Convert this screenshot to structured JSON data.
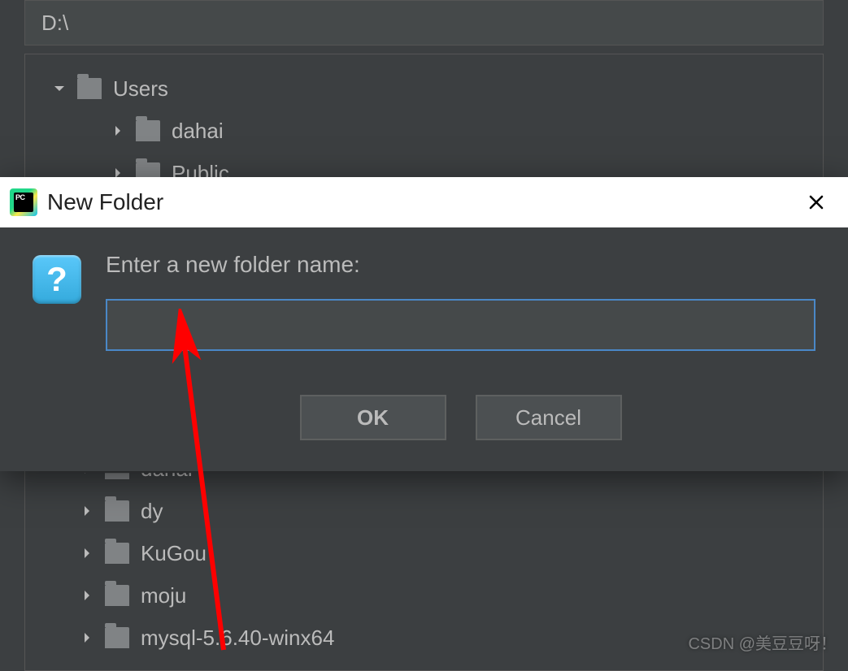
{
  "path_bar": {
    "value": "D:\\"
  },
  "tree": {
    "top": [
      {
        "label": "Users",
        "depth": 0,
        "expanded": true
      },
      {
        "label": "dahai",
        "depth": 1,
        "expanded": false
      },
      {
        "label": "Public",
        "depth": 1,
        "expanded": false
      }
    ],
    "bottom": [
      {
        "label": "dahai",
        "depth": 2,
        "expanded": false,
        "partial": true
      },
      {
        "label": "dy",
        "depth": 2,
        "expanded": false
      },
      {
        "label": "KuGou",
        "depth": 2,
        "expanded": false
      },
      {
        "label": "moju",
        "depth": 2,
        "expanded": false
      },
      {
        "label": "mysql-5.6.40-winx64",
        "depth": 2,
        "expanded": false
      }
    ]
  },
  "dialog": {
    "title": "New Folder",
    "prompt": "Enter a new folder name:",
    "input_value": "",
    "question_glyph": "?",
    "buttons": {
      "ok": "OK",
      "cancel": "Cancel"
    }
  },
  "watermark": "CSDN @美豆豆呀！"
}
